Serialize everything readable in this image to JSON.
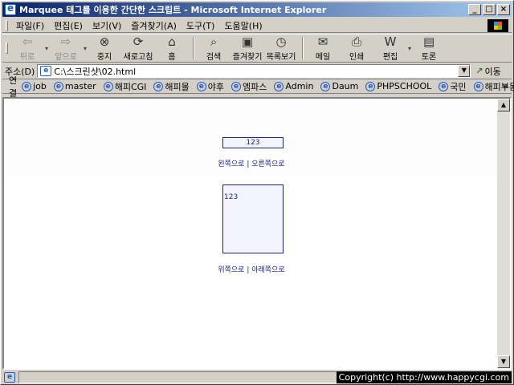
{
  "window": {
    "title": "Marquee 태그를 이용한 간단한 스크립트 - Microsoft Internet Explorer",
    "minimize_label": "_",
    "maximize_label": "□",
    "close_label": "×"
  },
  "menu": [
    "파일(F)",
    "편집(E)",
    "보기(V)",
    "즐겨찾기(A)",
    "도구(T)",
    "도움말(H)"
  ],
  "toolbar": {
    "back": "뒤로",
    "forward": "앞으로",
    "stop": "중지",
    "refresh": "새로고침",
    "home": "홈",
    "search": "검색",
    "favorites": "즐겨찾기",
    "history": "목록보기",
    "mail": "메일",
    "print": "인쇄",
    "edit": "편집",
    "discuss": "토론"
  },
  "address": {
    "label": "주소(D)",
    "value": "C:\\스크린샷\\02.html",
    "go_label": "이동"
  },
  "links": {
    "label": "연결",
    "items": [
      "job",
      "master",
      "해피CGI",
      "해피몰",
      "야후",
      "엠파스",
      "Admin",
      "Daum",
      "PHPSCHOOL",
      "국민",
      "해피부동산"
    ],
    "more": "»"
  },
  "content": {
    "marquee_horizontal_text": "123",
    "ctrl_left": "왼쪽으로",
    "ctrl_right": "오른쪽으로",
    "separator": " | ",
    "marquee_vertical_text": "123",
    "ctrl_up": "위쪽으로",
    "ctrl_down": "아래쪽으로"
  },
  "status": {
    "copyright": "Copyright(c) http://www.happycgi.com"
  }
}
